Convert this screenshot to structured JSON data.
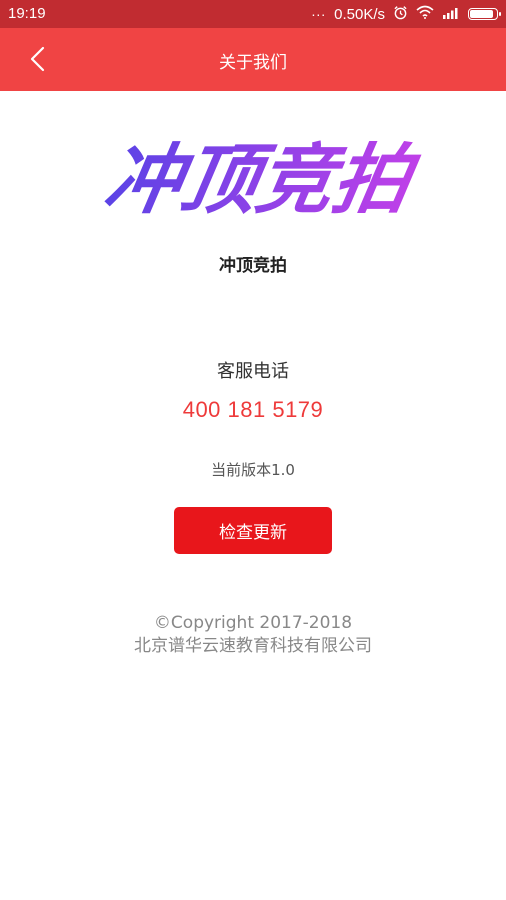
{
  "status_bar": {
    "time": "19:19",
    "dots": "...",
    "network_speed": "0.50K/s",
    "battery_level": 0.9
  },
  "nav": {
    "title": "关于我们"
  },
  "logo": {
    "text": "冲顶竞拍",
    "gradient_start": "#5a43e6",
    "gradient_end": "#c040e8"
  },
  "app": {
    "name": "冲顶竞拍"
  },
  "service": {
    "label": "客服电话",
    "phone": "400 181 5179"
  },
  "version": {
    "text": "当前版本1.0"
  },
  "update_button": {
    "label": "检查更新"
  },
  "footer": {
    "copyright": "©Copyright 2017-2018",
    "company": "北京谱华云速教育科技有限公司"
  },
  "colors": {
    "status_bar": "#c12c31",
    "nav_bar": "#f04444",
    "accent": "#ee3a3a",
    "button": "#e8161b"
  }
}
